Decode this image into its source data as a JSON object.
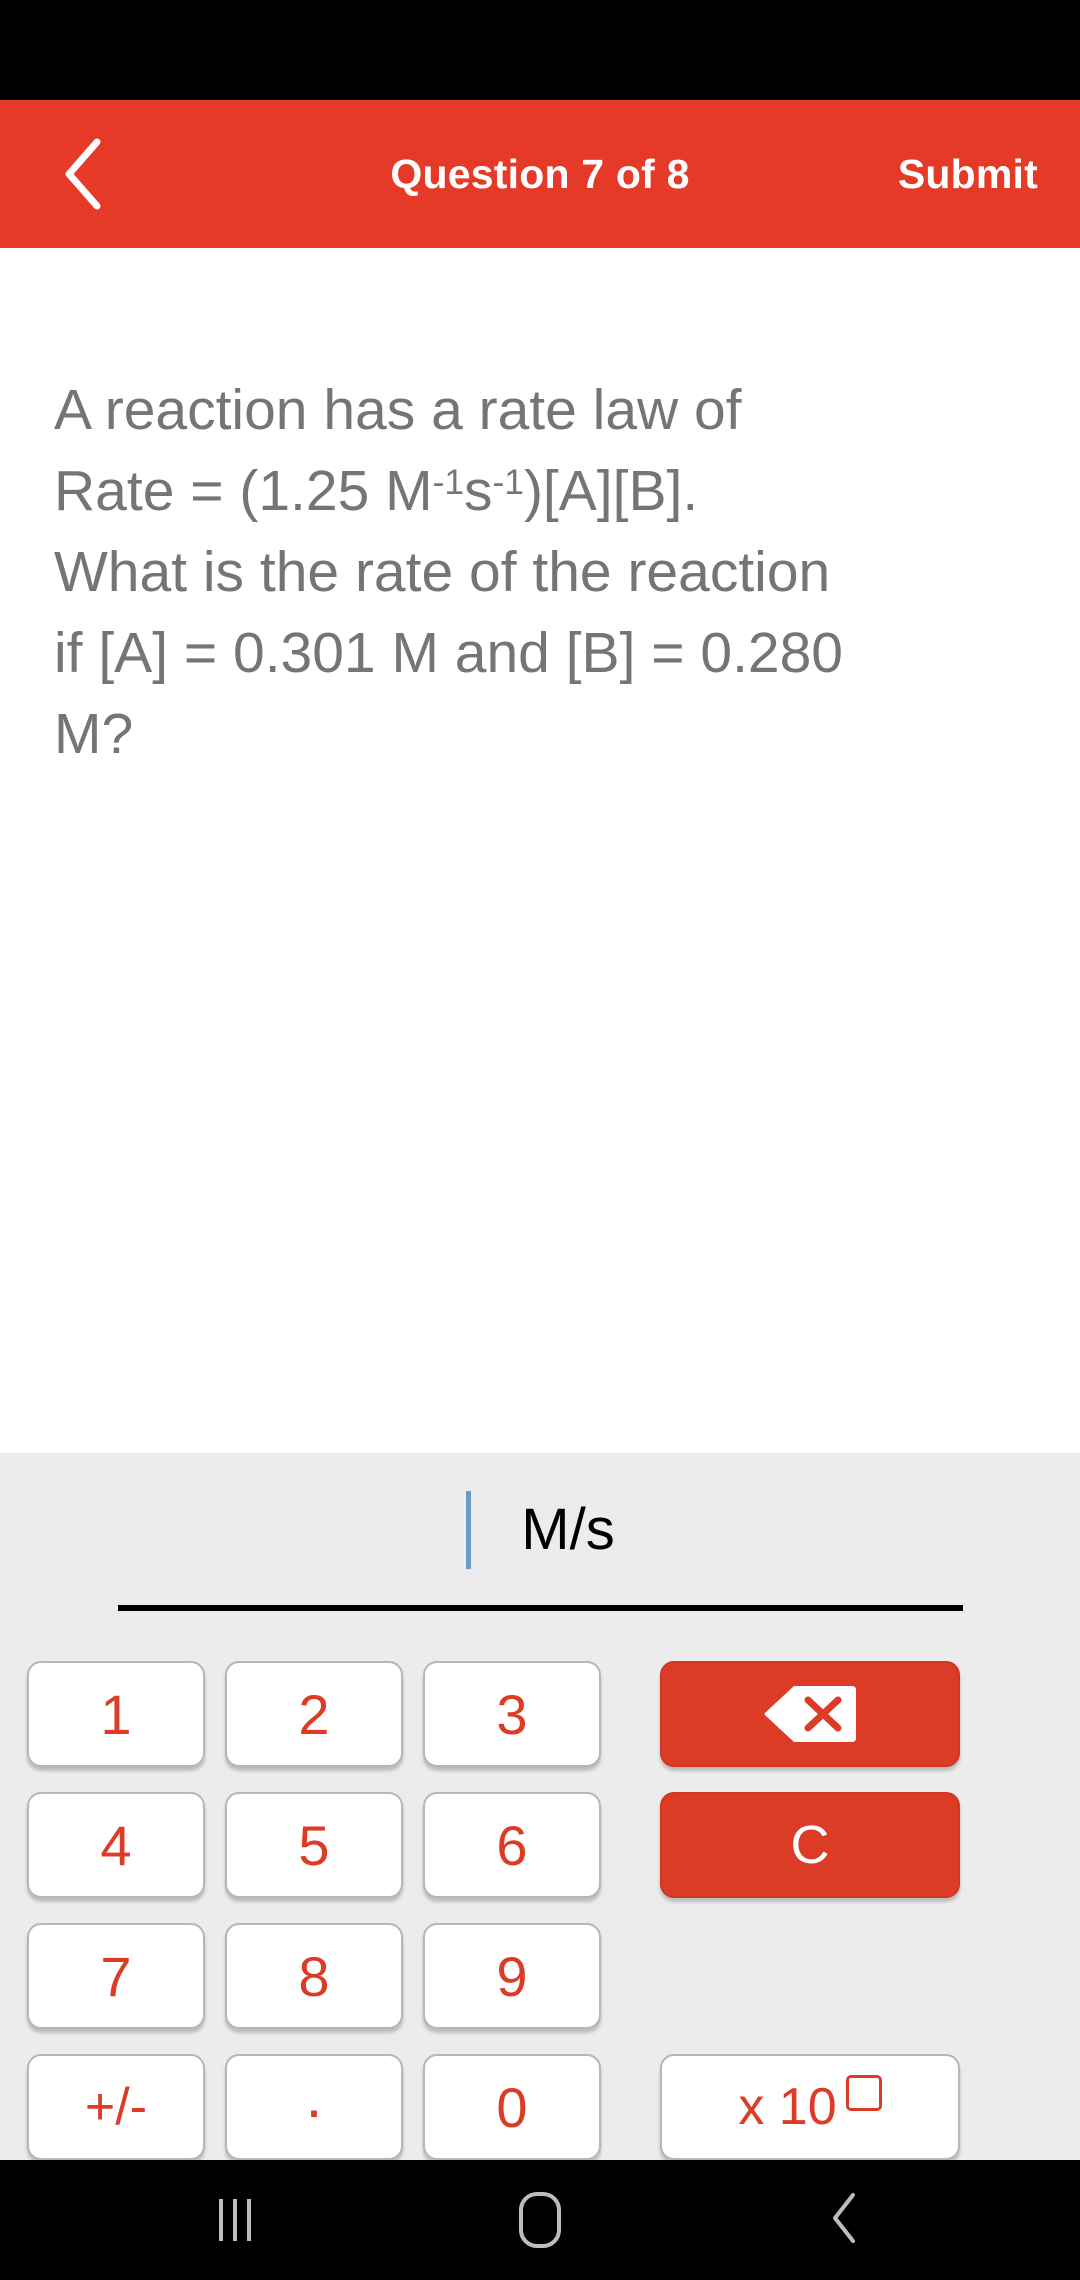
{
  "status_bar": {
    "background": "#000000"
  },
  "header": {
    "title": "Question 7 of 8",
    "submit_label": "Submit",
    "back_icon": "chevron-left-icon",
    "background": "#E43A27",
    "text_color": "#FFFFFF"
  },
  "question": {
    "line1": "A reaction has a rate law of",
    "line2_prefix": "Rate = (1.25 M",
    "exp1": "-1",
    "line2_mid": "s",
    "exp2": "-1",
    "line2_suffix": ")[A][B].",
    "line3": "What is the rate of the reaction",
    "line4": "if [A] = 0.301 M and [B] = 0.280",
    "line5": "M?",
    "text_color": "#757575"
  },
  "answer": {
    "value": "",
    "unit": "M/s",
    "cursor_color": "#6E9BC5",
    "underline_color": "#000000"
  },
  "keypad": {
    "background": "#ECECEC",
    "number_keys": [
      {
        "label": "1",
        "name": "key-1"
      },
      {
        "label": "2",
        "name": "key-2"
      },
      {
        "label": "3",
        "name": "key-3"
      },
      {
        "label": "4",
        "name": "key-4"
      },
      {
        "label": "5",
        "name": "key-5"
      },
      {
        "label": "6",
        "name": "key-6"
      },
      {
        "label": "7",
        "name": "key-7"
      },
      {
        "label": "8",
        "name": "key-8"
      },
      {
        "label": "9",
        "name": "key-9"
      },
      {
        "label": "+/-",
        "name": "key-plus-minus"
      },
      {
        "label": ".",
        "name": "key-decimal"
      },
      {
        "label": "0",
        "name": "key-0"
      }
    ],
    "backspace": {
      "icon": "backspace-icon",
      "background": "#DC3B26"
    },
    "clear": {
      "label": "C",
      "background": "#DC3B26"
    },
    "exponent": {
      "label": "x 10",
      "exponent_placeholder": "",
      "text_color": "#DC3B26"
    },
    "key_text_color": "#DC3B26"
  },
  "nav_bar": {
    "recents_icon": "recents-icon",
    "home_icon": "home-icon",
    "back_icon": "nav-back-icon",
    "background": "#000000",
    "icon_color": "#BDBDBD"
  }
}
